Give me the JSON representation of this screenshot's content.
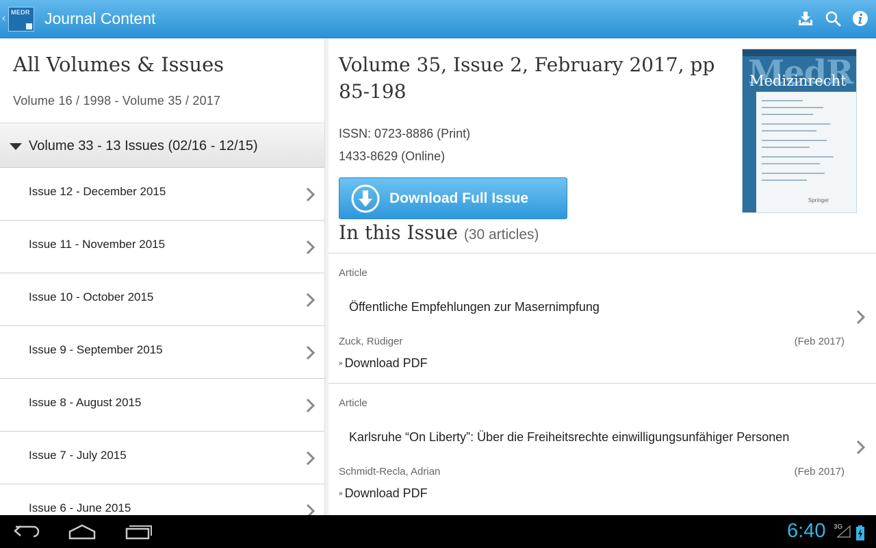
{
  "app": {
    "title": "Journal Content",
    "logo_text": "MEDR",
    "up_glyph": "‹",
    "actions": [
      {
        "icon": "download-tray-icon"
      },
      {
        "icon": "search-icon"
      },
      {
        "icon": "info-icon"
      }
    ],
    "accent_color": "#2a92d6"
  },
  "left": {
    "title": "All Volumes & Issues",
    "range": "Volume 16 / 1998 - Volume 35 / 2017",
    "volume_header": {
      "main": "Volume 33 - 13 Issues",
      "range": "(02/16 - 12/15)",
      "icon": "collapse-triangle-icon"
    },
    "issues": [
      {
        "label": "Issue 12 - December 2015"
      },
      {
        "label": "Issue 11 - November 2015"
      },
      {
        "label": "Issue 10 - October 2015"
      },
      {
        "label": "Issue 9 - September 2015"
      },
      {
        "label": "Issue 8 - August 2015"
      },
      {
        "label": "Issue 7 - July 2015"
      },
      {
        "label": "Issue 6 - June 2015"
      }
    ]
  },
  "right": {
    "heading": "Volume 35, Issue 2, February 2017, pp 85-198",
    "issn_print": "ISSN: 0723-8886 (Print)",
    "issn_online": "1433-8629 (Online)",
    "download_button": "Download Full Issue",
    "in_issue_label": "In this Issue",
    "in_issue_count": "(30 articles)",
    "cover": {
      "title": "MedR",
      "subtitle": "Medizinrecht",
      "publisher": "Springer"
    },
    "articles": [
      {
        "type": "Article",
        "title": "Öffentliche Empfehlungen zur Masernimpfung",
        "author": "Zuck, Rüdiger",
        "date": "(Feb 2017)",
        "pdf_label": "Download PDF"
      },
      {
        "type": "Article",
        "title": "Karlsruhe “On Liberty”: Über die Freiheitsrechte einwilligungsunfähiger Personen",
        "author": "Schmidt-Recla, Adrian",
        "date": "(Feb 2017)",
        "pdf_label": "Download PDF"
      }
    ]
  },
  "system": {
    "clock": "6:40",
    "network": "3G",
    "clock_color": "#33b5e5"
  }
}
